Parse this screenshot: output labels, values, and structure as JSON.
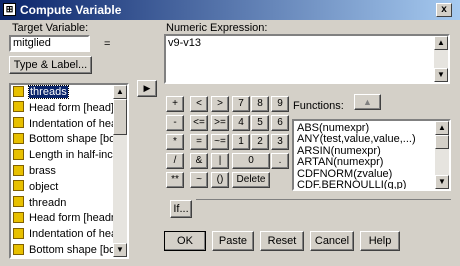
{
  "window": {
    "title": "Compute Variable",
    "close_label": "x",
    "app_icon": "spss-icon"
  },
  "target": {
    "label": "Target Variable:",
    "value": "mitglied",
    "equals": "=",
    "type_label_button": "Type & Label..."
  },
  "expression": {
    "label": "Numeric Expression:",
    "value": "v9-v13"
  },
  "transfer_button": "▶",
  "variables": [
    {
      "label": "threads",
      "selected": true
    },
    {
      "label": "Head form [head]",
      "selected": false
    },
    {
      "label": "Indentation of head",
      "selected": false
    },
    {
      "label": "Bottom shape [both",
      "selected": false
    },
    {
      "label": "Length in half-inche",
      "selected": false
    },
    {
      "label": "brass",
      "selected": false
    },
    {
      "label": "object",
      "selected": false
    },
    {
      "label": "threadn",
      "selected": false
    },
    {
      "label": "Head form [headn]",
      "selected": false
    },
    {
      "label": "Indentation of head",
      "selected": false
    },
    {
      "label": "Bottom shape [botts",
      "selected": false
    }
  ],
  "keypad": [
    [
      "+",
      "<",
      ">",
      "7",
      "8",
      "9"
    ],
    [
      "-",
      "<=",
      ">=",
      "4",
      "5",
      "6"
    ],
    [
      "*",
      "=",
      "~=",
      "1",
      "2",
      "3"
    ],
    [
      "/",
      "&",
      "|",
      "0",
      "."
    ],
    [
      "**",
      "~",
      "()",
      "Delete"
    ]
  ],
  "functions": {
    "label": "Functions:",
    "up_button": "▲",
    "items": [
      "ABS(numexpr)",
      "ANY(test,value,value,...)",
      "ARSIN(numexpr)",
      "ARTAN(numexpr)",
      "CDFNORM(zvalue)",
      "CDF.BERNOULLI(q,p)"
    ]
  },
  "if_button": "If...",
  "buttons": {
    "ok": "OK",
    "paste": "Paste",
    "reset": "Reset",
    "cancel": "Cancel",
    "help": "Help"
  }
}
